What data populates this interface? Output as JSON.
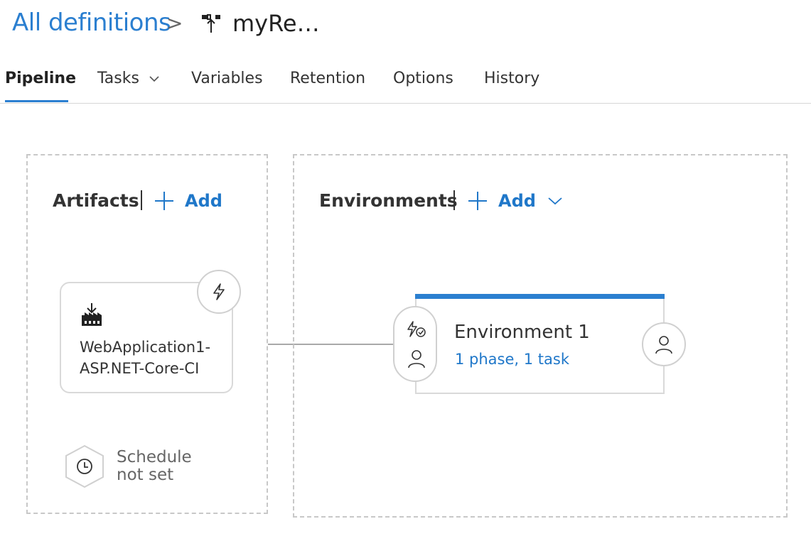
{
  "breadcrumb": {
    "root_label": "All definitions",
    "separator": ">",
    "definition_name": "myRe…",
    "definition_icon": "release-definition-icon"
  },
  "tabs": [
    {
      "label": "Pipeline",
      "active": true
    },
    {
      "label": "Tasks",
      "active": false,
      "dropdown": true
    },
    {
      "label": "Variables",
      "active": false
    },
    {
      "label": "Retention",
      "active": false
    },
    {
      "label": "Options",
      "active": false
    },
    {
      "label": "History",
      "active": false
    }
  ],
  "artifacts": {
    "title": "Artifacts",
    "add_label": "Add",
    "items": [
      {
        "name": "WebApplication1-\nASP.NET-Core-CI",
        "icon": "build-artifact-icon",
        "trigger_icon": "lightning-icon"
      }
    ],
    "schedule": {
      "line1": "Schedule",
      "line2": "not set",
      "icon": "clock-icon"
    }
  },
  "environments": {
    "title": "Environments",
    "add_label": "Add",
    "items": [
      {
        "name": "Environment 1",
        "summary": "1 phase, 1 task",
        "pre_icons": [
          "trigger-check-icon",
          "person-icon"
        ],
        "post_icon": "person-icon"
      }
    ]
  },
  "colors": {
    "accent": "#2b7fd0",
    "link": "#1f77c9",
    "border": "#d9d9d9"
  }
}
